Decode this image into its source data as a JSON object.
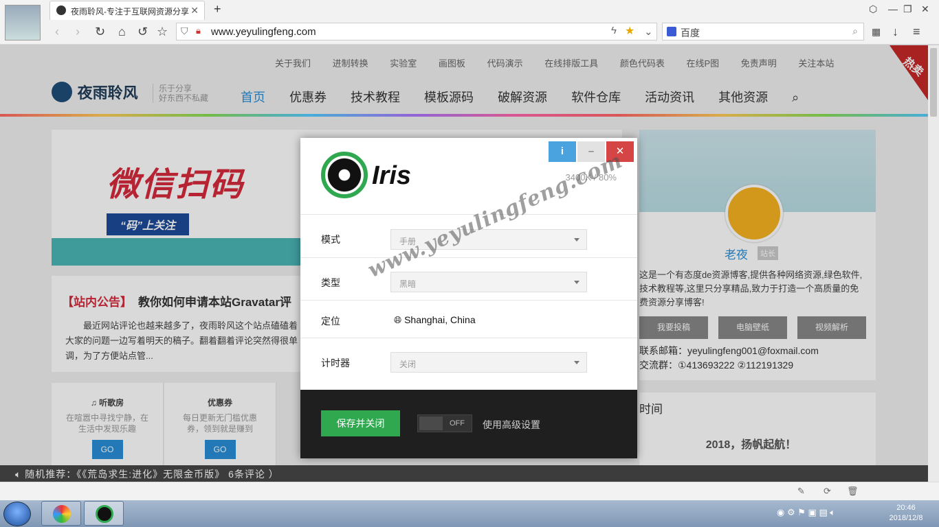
{
  "browser": {
    "tab_title": "夜雨聆风-专注于互联网资源分享",
    "url": "www.yeyulingfeng.com",
    "search_engine": "百度"
  },
  "site": {
    "topnav": [
      "关于我们",
      "进制转换",
      "实验室",
      "画图板",
      "代码演示",
      "在线排版工具",
      "颜色代码表",
      "在线P图",
      "免责声明",
      "关注本站"
    ],
    "name": "夜雨聆风",
    "slogan1": "乐于分享",
    "slogan2": "好东西不私藏",
    "mainnav": [
      "首页",
      "优惠券",
      "技术教程",
      "模板源码",
      "破解资源",
      "软件仓库",
      "活动资讯",
      "其他资源"
    ],
    "hot_ribbon": "热卖",
    "banner": {
      "title": "微信扫码",
      "sub": "“码”上关注"
    },
    "notice": {
      "tag": "【站内公告】",
      "title": "教你如何申请本站Gravatar评",
      "body": "最近网站评论也越来越多了，夜雨聆风这个站点磕磕着大家的问题一边写着明天的稿子。翻着翻着评论突然得很单调，为了方便站点管..."
    },
    "cards": [
      {
        "title": "♫ 听歌房",
        "desc": "在喧嚣中寻找宁静，在生活中发现乐趣",
        "go": "GO"
      },
      {
        "title": "优惠券",
        "desc": "每日更新无门槛优惠券，领到就是赚到",
        "go": "GO"
      }
    ],
    "sidebar": {
      "name": "老夜",
      "badge": "站长",
      "desc": "这是一个有态度de资源博客,提供各种网络资源,绿色软件,技术教程等,这里只分享精品,致力于打造一个高质量的免费资源分享博客!",
      "buttons": [
        "我要投稿",
        "电脑壁纸",
        "视频解析"
      ],
      "mail": "联系邮箱：yeyulingfeng001@foxmail.com",
      "qq": "交流群：①413693222 ②112191329"
    },
    "timebox": {
      "title": "时间",
      "text": "2018，扬帆起航！"
    },
    "ticker": "随机推荐：《《荒岛求生:进化》无限金币版》  6条评论  ）"
  },
  "dialog": {
    "app_name": "Iris",
    "stats": "3400K / 80%",
    "btn_info": "i",
    "btn_min": "–",
    "btn_close": "✕",
    "rows": [
      {
        "label": "模式",
        "value": "手册"
      },
      {
        "label": "类型",
        "value": "黑暗"
      },
      {
        "label": "定位",
        "value": "Shanghai, China"
      },
      {
        "label": "计时器",
        "value": "关闭"
      }
    ],
    "save_label": "保存并关闭",
    "toggle_state": "OFF",
    "advanced_label": "使用高级设置"
  },
  "watermark": "www.yeyulingfeng.com",
  "taskbar": {
    "time": "20:46",
    "date": "2018/12/8"
  }
}
